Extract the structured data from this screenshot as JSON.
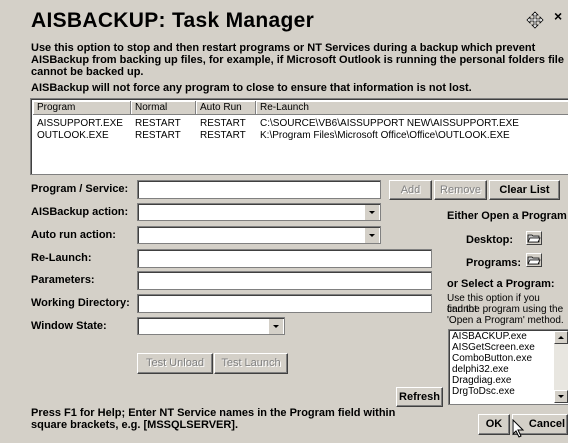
{
  "window": {
    "title": "AISBACKUP: Task Manager",
    "close_glyph": "×",
    "move_icon": "move-cursor-icon"
  },
  "description": "Use this option to stop and then restart programs or NT Services during a backup which prevent AISBackup from backing up files, for example, if Microsoft Outlook is running the personal folders file cannot be backed up.",
  "warning": "AISBackup will not force any program to close to ensure that information is not lost.",
  "program_list": {
    "headers": [
      "Program",
      "Normal",
      "Auto Run",
      "Re-Launch"
    ],
    "rows": [
      [
        "AISSUPPORT.EXE",
        "RESTART",
        "RESTART",
        "C:\\SOURCE\\VB6\\AISSUPPORT NEW\\AISSUPPORT.EXE"
      ],
      [
        "OUTLOOK.EXE",
        "RESTART",
        "RESTART",
        "K:\\Program Files\\Microsoft Office\\Office\\OUTLOOK.EXE"
      ]
    ]
  },
  "form": {
    "program_label": "Program / Service:",
    "aisbackup_action_label": "AISBackup action:",
    "auto_run_label": "Auto run action:",
    "relaunch_label": "Re-Launch:",
    "parameters_label": "Parameters:",
    "working_dir_label": "Working Directory:",
    "window_state_label": "Window State:"
  },
  "buttons": {
    "add": "Add",
    "remove": "Remove",
    "clear_list": "Clear List",
    "test_unload": "Test Unload",
    "test_launch": "Test Launch",
    "refresh": "Refresh",
    "ok": "OK",
    "cancel": "Cancel"
  },
  "right_panel": {
    "either_open": "Either Open a Program",
    "desktop": "Desktop:",
    "programs": "Programs:",
    "or_select": "or Select a Program:",
    "hint_line1": "Use this option if you cannot",
    "hint_line2": "find the program using the",
    "hint_line3": "'Open a Program' method.",
    "programs_list": [
      "AISBACKUP.exe",
      "AISGetScreen.exe",
      "ComboButton.exe",
      "delphi32.exe",
      "Dragdiag.exe",
      "DrgToDsc.exe"
    ]
  },
  "footer": {
    "line1": "Press F1 for Help; Enter NT Service names in the Program field within",
    "line2": "square brackets, e.g. [MSSQLSERVER]."
  }
}
